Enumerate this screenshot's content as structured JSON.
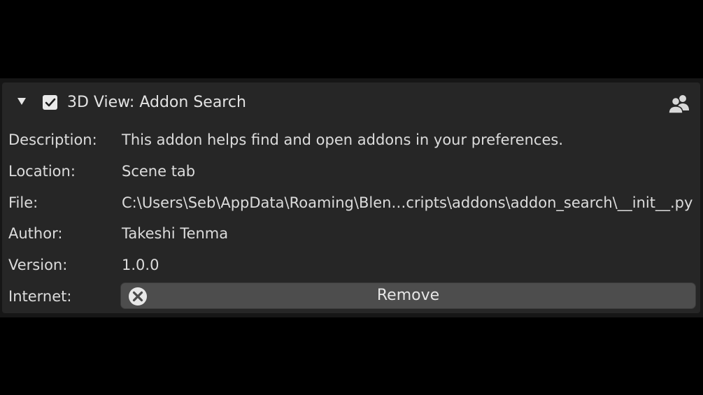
{
  "addon": {
    "title": "3D View: Addon Search",
    "enabled": true,
    "expanded": true,
    "header_icons": {
      "disclosure": "disclosure-triangle-down-icon",
      "checkbox": "checkmark-icon",
      "community": "users-icon"
    }
  },
  "details": {
    "description_label": "Description:",
    "description_value": "This addon helps find and open addons in your preferences.",
    "location_label": "Location:",
    "location_value": "Scene tab",
    "file_label": "File:",
    "file_value": "C:\\Users\\Seb\\AppData\\Roaming\\Blen…cripts\\addons\\addon_search\\__init__.py",
    "author_label": "Author:",
    "author_value": "Takeshi Tenma",
    "version_label": "Version:",
    "version_value": "1.0.0",
    "internet_label": "Internet:"
  },
  "actions": {
    "remove_label": "Remove",
    "remove_icon": "close-circle-icon"
  },
  "colors": {
    "background": "#000000",
    "panel_border": "#161616",
    "panel": "#262626",
    "button": "#4d4d4d",
    "text": "#dcdcdc",
    "checkbox": "#e9e9e9"
  }
}
